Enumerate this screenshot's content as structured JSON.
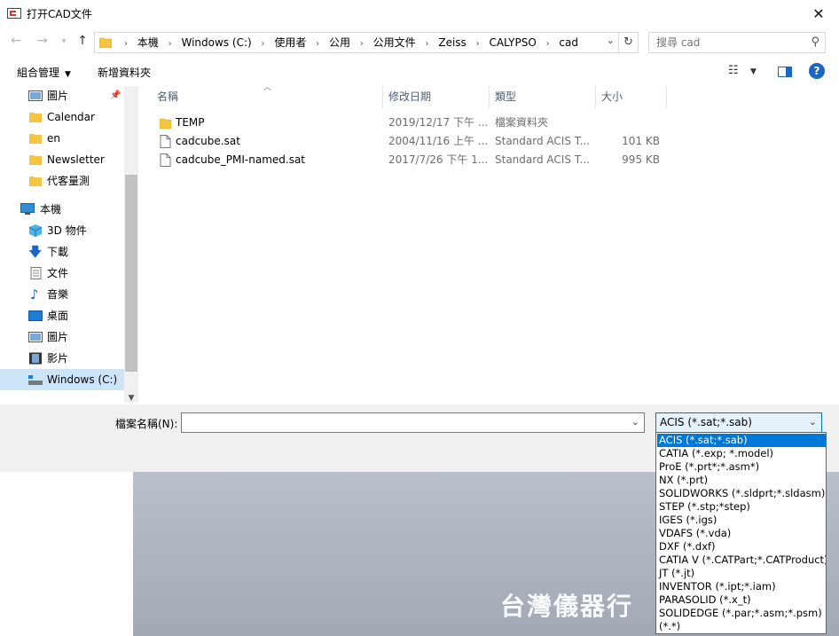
{
  "window": {
    "title": "打开CAD文件"
  },
  "nav": {
    "breadcrumbs": [
      "本機",
      "Windows (C:)",
      "使用者",
      "公用",
      "公用文件",
      "Zeiss",
      "CALYPSO",
      "cad"
    ],
    "search_placeholder": "搜尋 cad"
  },
  "toolbar": {
    "organize": "組合管理",
    "new_folder": "新增資料夾"
  },
  "sidebar": {
    "quick_access": [
      "圖片",
      "Calendar",
      "en",
      "Newsletter",
      "代客量測"
    ],
    "this_pc": "本機",
    "this_pc_items": [
      "3D 物件",
      "下載",
      "文件",
      "音樂",
      "桌面",
      "圖片",
      "影片",
      "Windows (C:)"
    ]
  },
  "columns": {
    "name": "名稱",
    "date": "修改日期",
    "type": "類型",
    "size": "大小"
  },
  "files": [
    {
      "name": "TEMP",
      "date": "2019/12/17 下午 ...",
      "type": "檔案資料夾",
      "size": "",
      "icon": "folder-icon"
    },
    {
      "name": "cadcube.sat",
      "date": "2004/11/16 上午 ...",
      "type": "Standard ACIS T...",
      "size": "101 KB",
      "icon": "file-icon"
    },
    {
      "name": "cadcube_PMI-named.sat",
      "date": "2017/7/26 下午 1...",
      "type": "Standard ACIS T...",
      "size": "995 KB",
      "icon": "file-icon"
    }
  ],
  "bottom": {
    "filename_label": "檔案名稱(N):",
    "filename_value": "",
    "filetype_selected": "ACIS (*.sat;*.sab)"
  },
  "filetype_options": [
    "ACIS (*.sat;*.sab)",
    "CATIA (*.exp; *.model)",
    "ProE (*.prt*;*.asm*)",
    "NX (*.prt)",
    "SOLIDWORKS (*.sldprt;*.sldasm)",
    "STEP (*.stp;*step)",
    "IGES (*.igs)",
    "VDAFS (*.vda)",
    "DXF (*.dxf)",
    "CATIA V (*.CATPart;*.CATProduct)",
    "JT (*.jt)",
    "INVENTOR (*.ipt;*.iam)",
    "PARASOLID (*.x_t)",
    "SOLIDEDGE (*.par;*.asm;*.psm)",
    " (*.*)"
  ],
  "watermark": "台灣儀器行",
  "colors": {
    "accent": "#0078d7",
    "selection": "#cce4f7",
    "folder": "#f5c542"
  }
}
